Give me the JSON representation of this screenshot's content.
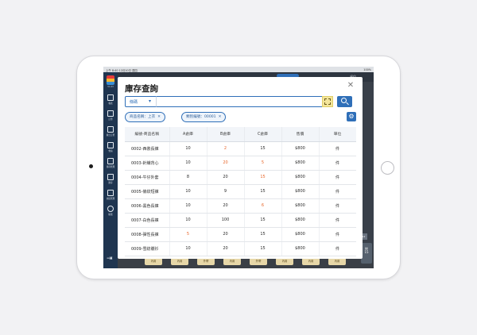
{
  "status_bar": {
    "left": "上午 8:40   12月10日 週四",
    "right": "100%"
  },
  "sidebar": {
    "version": "V1.03",
    "items": [
      {
        "label": "報表",
        "icon": "report-icon"
      },
      {
        "label": "訂單",
        "icon": "order-icon"
      },
      {
        "label": "線上訂單",
        "icon": "online-order-icon"
      },
      {
        "label": "會員",
        "icon": "member-icon"
      },
      {
        "label": "寄存管理",
        "icon": "storage-icon"
      },
      {
        "label": "庫存",
        "icon": "inventory-icon"
      },
      {
        "label": "交班管理",
        "icon": "shift-icon"
      },
      {
        "label": "帳號",
        "icon": "account-icon"
      }
    ]
  },
  "background": {
    "header_right": "桌位",
    "tiles": [
      "內用",
      "內用",
      "外帶",
      "內用",
      "外帶",
      "內用",
      "內用",
      "內用"
    ],
    "right_card_label": "15",
    "side_badge": "2/12"
  },
  "modal": {
    "title": "庫存查詢",
    "close_label": "✕",
    "search": {
      "select_value": "條碼",
      "input_value": "",
      "input_placeholder": ""
    },
    "filters": [
      {
        "label": "商品名稱：上衣"
      },
      {
        "label": "類別編號：00001"
      }
    ],
    "table": {
      "columns": [
        "編號-商品名稱",
        "A倉庫",
        "B倉庫",
        "C倉庫",
        "售價",
        "單位"
      ],
      "rows": [
        {
          "name": "0002-西裝長褲",
          "a": "10",
          "b": "2",
          "c": "15",
          "price": "$800",
          "unit": "件",
          "hl": [
            "b"
          ]
        },
        {
          "name": "0003-針織背心",
          "a": "10",
          "b": "20",
          "c": "5",
          "price": "$800",
          "unit": "件",
          "hl": [
            "b",
            "c"
          ]
        },
        {
          "name": "0004-牛仔外套",
          "a": "8",
          "b": "20",
          "c": "15",
          "price": "$800",
          "unit": "件",
          "hl": [
            "c"
          ]
        },
        {
          "name": "0005-條紋短褲",
          "a": "10",
          "b": "9",
          "c": "15",
          "price": "$800",
          "unit": "件",
          "hl": []
        },
        {
          "name": "0006-黑色長褲",
          "a": "10",
          "b": "20",
          "c": "6",
          "price": "$800",
          "unit": "件",
          "hl": [
            "c"
          ]
        },
        {
          "name": "0007-白色長褲",
          "a": "10",
          "b": "100",
          "c": "15",
          "price": "$800",
          "unit": "件",
          "hl": []
        },
        {
          "name": "0008-彈性長褲",
          "a": "5",
          "b": "20",
          "c": "15",
          "price": "$800",
          "unit": "件",
          "hl": [
            "a"
          ]
        },
        {
          "name": "0009-雪紡襯衫",
          "a": "10",
          "b": "20",
          "c": "15",
          "price": "$800",
          "unit": "件",
          "hl": []
        }
      ]
    }
  },
  "colors": {
    "accent": "#2f6fb8",
    "highlight": "#e8672b",
    "scan_button": "#f3e59a",
    "sidebar": "#1f3550"
  }
}
